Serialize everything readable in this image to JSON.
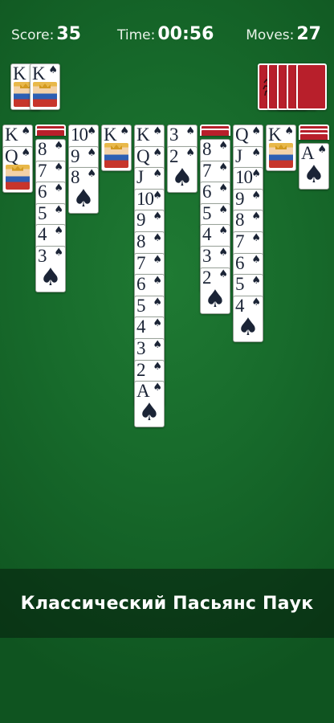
{
  "header": {
    "score_label": "Score:",
    "score_value": "35",
    "time_label": "Time:",
    "time_value": "00:56",
    "moves_label": "Moves:",
    "moves_value": "27"
  },
  "foundation": {
    "completed_kings": [
      "K",
      "K"
    ],
    "suit": "♠"
  },
  "stock": {
    "remaining_deals": 5,
    "back_icon": "spider-icon"
  },
  "tableau": [
    {
      "hidden": 0,
      "cards": [
        "K",
        "Q"
      ]
    },
    {
      "hidden": 2,
      "cards": [
        "8",
        "7",
        "6",
        "5",
        "4",
        "3"
      ]
    },
    {
      "hidden": 0,
      "cards": [
        "10",
        "9",
        "8"
      ]
    },
    {
      "hidden": 0,
      "cards": [
        "K"
      ]
    },
    {
      "hidden": 0,
      "cards": [
        "K",
        "Q",
        "J",
        "10",
        "9",
        "8",
        "7",
        "6",
        "5",
        "4",
        "3",
        "2",
        "A"
      ]
    },
    {
      "hidden": 0,
      "cards": [
        "3",
        "2"
      ]
    },
    {
      "hidden": 2,
      "cards": [
        "8",
        "7",
        "6",
        "5",
        "4",
        "3",
        "2"
      ]
    },
    {
      "hidden": 0,
      "cards": [
        "Q",
        "J",
        "10",
        "9",
        "8",
        "7",
        "6",
        "5",
        "4"
      ]
    },
    {
      "hidden": 0,
      "cards": [
        "K"
      ]
    },
    {
      "hidden": 3,
      "cards": [
        "A"
      ]
    }
  ],
  "colors": {
    "felt": "#1f7a33",
    "card_back": "#b81f2b",
    "ink": "#1b2436"
  },
  "banner": {
    "text": "Классический Пасьянс Паук"
  }
}
